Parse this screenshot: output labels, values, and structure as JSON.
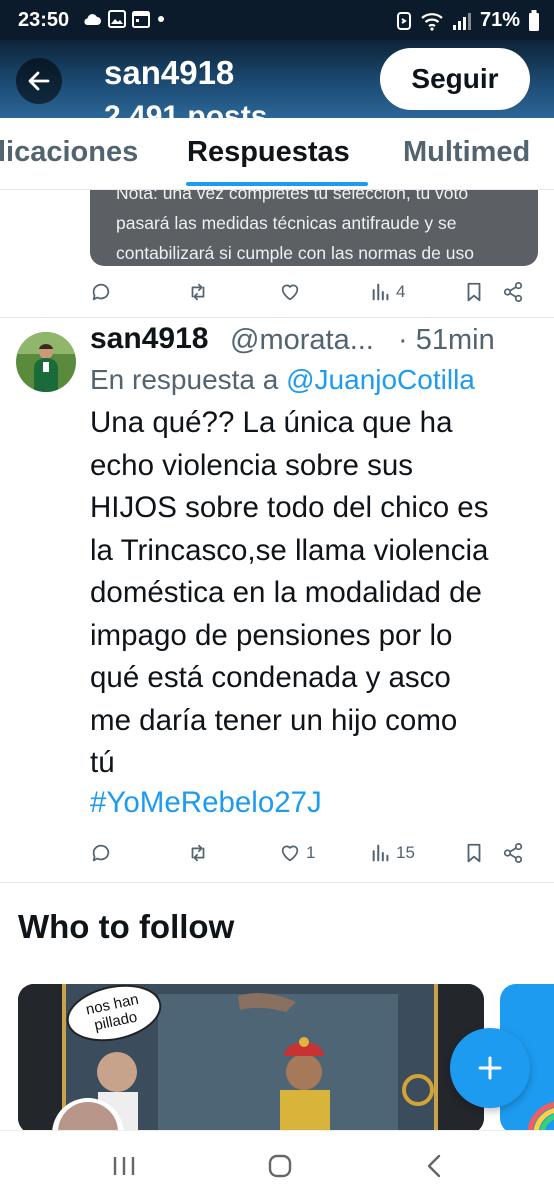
{
  "status_bar": {
    "time": "23:50",
    "battery": "71%",
    "icons_left": [
      "cloud-icon",
      "image-icon",
      "calendar-icon",
      "dot-icon"
    ],
    "icons_right": [
      "alarm-icon",
      "wifi-icon",
      "signal-icon",
      "battery-icon"
    ]
  },
  "header": {
    "name": "san4918",
    "subtitle": "2.491 posts",
    "follow_label": "Seguir"
  },
  "tabs": [
    {
      "label": "licaciones",
      "active": false
    },
    {
      "label": "Respuestas",
      "active": true
    },
    {
      "label": "Multimed",
      "active": false
    }
  ],
  "tweet1": {
    "poll_note_lines": [
      "Nota: una vez completes tu selección, tu voto",
      "pasará las medidas técnicas antifraude y se",
      "contabilizará si cumple con las normas de uso"
    ],
    "views": "4"
  },
  "tweet2": {
    "name": "san4918",
    "handle": "@morata...",
    "time": "· 51min",
    "reply_prefix": "En respuesta a ",
    "reply_mention": "@JuanjoCotilla",
    "body_lines": [
      "Una qué?? La única que ha",
      "echo violencia sobre sus",
      "HIJOS sobre todo del chico es",
      "la Trincasco,se llama violencia",
      "doméstica en la modalidad de",
      "impago de pensiones por lo",
      "qué está condenada y asco",
      "me daría tener un hijo como",
      "tú"
    ],
    "hashtag": "#YoMeRebelo27J",
    "likes": "1",
    "views": "15"
  },
  "who_to_follow": {
    "title": "Who to follow",
    "card_speech": "nos han pillado"
  },
  "colors": {
    "accent": "#1d9bf0",
    "text_primary": "#0f1419",
    "text_secondary": "#536471",
    "header_bg": "#1c4b74"
  }
}
